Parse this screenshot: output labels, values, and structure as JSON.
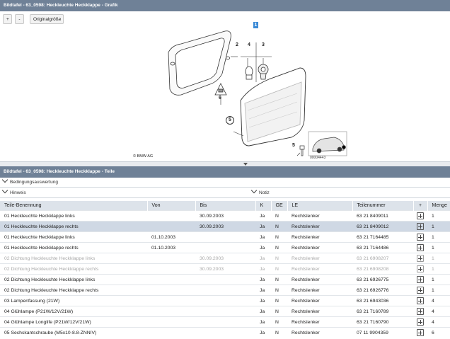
{
  "graphic_panel": {
    "title": "Bildtafel - 63_0598: Heckleuchte Heckklappe - Grafik",
    "buttons": {
      "zoom_in": "+",
      "zoom_out": "-",
      "original_size": "Originalgröße"
    },
    "callouts": [
      "1",
      "2",
      "4",
      "3",
      "6",
      "5",
      "5"
    ],
    "copyright": "© BMW AG",
    "inset_code": "00004443"
  },
  "parts_panel": {
    "title": "Bildtafel - 63_0598: Heckleuchte Heckklappe - Teile",
    "sections": {
      "conditions": "Bedingungsauswertung",
      "notes_left": "Hinweis",
      "notes_right": "Notiz"
    },
    "columns": [
      "Teile-Benennung",
      "Von",
      "Bis",
      "K",
      "GE",
      "LE",
      "Teilenummer",
      "+",
      "Menge"
    ],
    "rows": [
      {
        "name": "01 Heckleuchte Heckklappe links",
        "von": "",
        "bis": "30.09.2003",
        "k": "Ja",
        "ge": "N",
        "le": "Rechtslenker",
        "nr": "63 21 8409011",
        "qty": "1"
      },
      {
        "name": "01 Heckleuchte Heckklappe rechts",
        "von": "",
        "bis": "30.09.2003",
        "k": "Ja",
        "ge": "N",
        "le": "Rechtslenker",
        "nr": "63 21 8409012",
        "qty": "1"
      },
      {
        "name": "01 Heckleuchte Heckklappe links",
        "von": "01.10.2003",
        "bis": "",
        "k": "Ja",
        "ge": "N",
        "le": "Rechtslenker",
        "nr": "63 21 7164485",
        "qty": "1"
      },
      {
        "name": "01 Heckleuchte Heckklappe rechts",
        "von": "01.10.2003",
        "bis": "",
        "k": "Ja",
        "ge": "N",
        "le": "Rechtslenker",
        "nr": "63 21 7164486",
        "qty": "1"
      },
      {
        "name": "02 Dichtung Heckleuchte Heckklappe links",
        "von": "",
        "bis": "30.09.2003",
        "k": "Ja",
        "ge": "N",
        "le": "Rechtslenker",
        "nr": "63 21 6908207",
        "qty": "1"
      },
      {
        "name": "02 Dichtung Heckleuchte Heckklappe rechts",
        "von": "",
        "bis": "30.09.2003",
        "k": "Ja",
        "ge": "N",
        "le": "Rechtslenker",
        "nr": "63 21 6908208",
        "qty": "1"
      },
      {
        "name": "02 Dichtung Heckleuchte Heckklappe links",
        "von": "",
        "bis": "",
        "k": "Ja",
        "ge": "N",
        "le": "Rechtslenker",
        "nr": "63 21 6926775",
        "qty": "1"
      },
      {
        "name": "02 Dichtung Heckleuchte Heckklappe rechts",
        "von": "",
        "bis": "",
        "k": "Ja",
        "ge": "N",
        "le": "Rechtslenker",
        "nr": "63 21 6926776",
        "qty": "1"
      },
      {
        "name": "03 Lampenfassung (21W)",
        "von": "",
        "bis": "",
        "k": "Ja",
        "ge": "N",
        "le": "Rechtslenker",
        "nr": "63 21 6943036",
        "qty": "4"
      },
      {
        "name": "04 Glühlampe (P21W/12V/21W)",
        "von": "",
        "bis": "",
        "k": "Ja",
        "ge": "N",
        "le": "Rechtslenker",
        "nr": "63 21 7160789",
        "qty": "4"
      },
      {
        "name": "04 Glühlampe Longlife (P21W/12V/21W)",
        "von": "",
        "bis": "",
        "k": "Ja",
        "ge": "N",
        "le": "Rechtslenker",
        "nr": "63 21 7160790",
        "qty": "4"
      },
      {
        "name": "05 Sechskantschraube (M5x10-8.8-ZNNIV)",
        "von": "",
        "bis": "",
        "k": "Ja",
        "ge": "N",
        "le": "Rechtslenker",
        "nr": "07 11 9904359",
        "qty": "6"
      }
    ]
  }
}
